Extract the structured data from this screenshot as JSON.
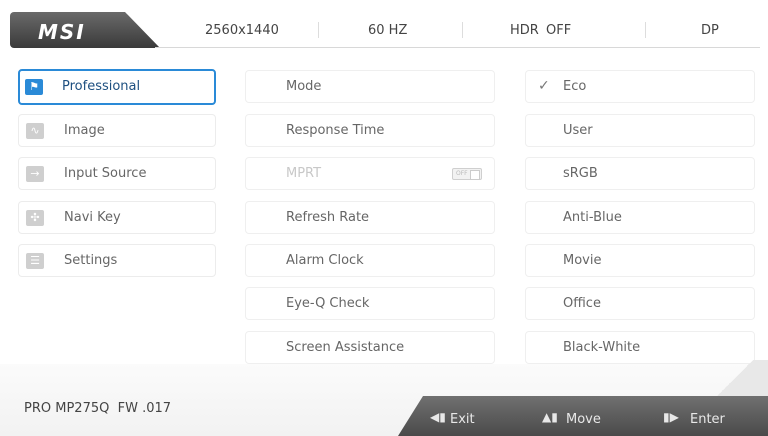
{
  "logo": {
    "text": "MSI"
  },
  "status": {
    "resolution": "2560x1440",
    "refresh": "60 HZ",
    "hdr_label": "HDR",
    "hdr_value": "OFF",
    "input": "DP"
  },
  "menu": {
    "items": [
      {
        "label": "Professional",
        "icon": "flag-icon",
        "active": true
      },
      {
        "label": "Image",
        "icon": "image-icon"
      },
      {
        "label": "Input Source",
        "icon": "arrow-right-icon"
      },
      {
        "label": "Navi Key",
        "icon": "navi-key-icon"
      },
      {
        "label": "Settings",
        "icon": "sliders-icon"
      }
    ]
  },
  "middle": {
    "items": [
      {
        "label": "Mode"
      },
      {
        "label": "Response Time"
      },
      {
        "label": "MPRT",
        "disabled": true,
        "toggle": "OFF"
      },
      {
        "label": "Refresh Rate"
      },
      {
        "label": "Alarm Clock"
      },
      {
        "label": "Eye-Q Check"
      },
      {
        "label": "Screen Assistance"
      }
    ]
  },
  "right": {
    "items": [
      {
        "label": "Eco",
        "selected": true
      },
      {
        "label": "User"
      },
      {
        "label": "sRGB"
      },
      {
        "label": "Anti-Blue"
      },
      {
        "label": "Movie"
      },
      {
        "label": "Office"
      },
      {
        "label": "Black-White"
      }
    ]
  },
  "footer": {
    "model": "PRO MP275Q",
    "firmware": "FW .017",
    "exit": "Exit",
    "move": "Move",
    "enter": "Enter"
  }
}
